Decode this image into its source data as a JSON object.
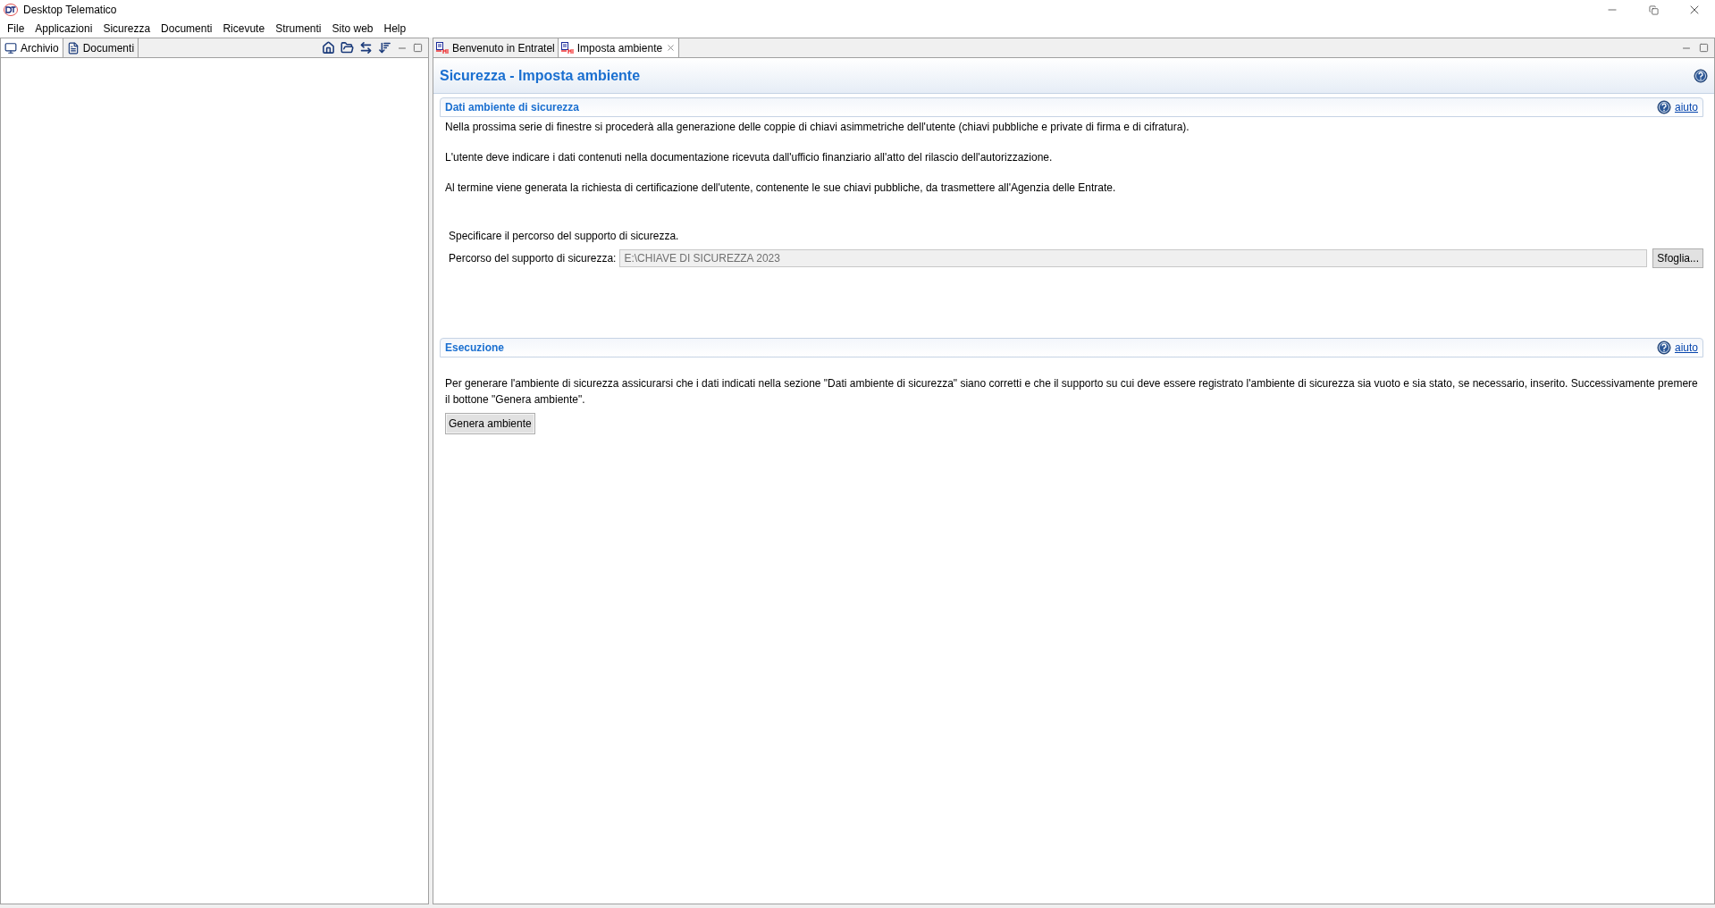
{
  "window": {
    "title": "Desktop Telematico"
  },
  "menu": [
    "File",
    "Applicazioni",
    "Sicurezza",
    "Documenti",
    "Ricevute",
    "Strumenti",
    "Sito web",
    "Help"
  ],
  "left_tabs": [
    {
      "label": "Archivio",
      "selected": true
    },
    {
      "label": "Documenti",
      "selected": false
    }
  ],
  "editor_tabs": [
    {
      "label": "Benvenuto in Entratel",
      "selected": false
    },
    {
      "label": "Imposta ambiente",
      "selected": true
    }
  ],
  "page_title": "Sicurezza - Imposta ambiente",
  "sections": [
    {
      "title": "Dati ambiente di sicurezza",
      "help": "aiuto",
      "paragraphs": [
        "Nella  prossima serie di finestre  si procederà  alla generazione delle coppie di chiavi asimmetriche dell'utente (chiavi pubbliche e private di firma e di cifratura).",
        "L'utente deve indicare i dati contenuti nella documentazione ricevuta dall'ufficio finanziario all'atto del rilascio dell'autorizzazione.",
        "Al termine viene generata la richiesta di certificazione dell'utente, contenente le sue chiavi pubbliche, da trasmettere all'Agenzia delle Entrate."
      ],
      "instruction": "Specificare il percorso del supporto di sicurezza.",
      "field": {
        "label": "Percorso del supporto di sicurezza:",
        "value": "E:\\CHIAVE DI SICUREZZA 2023",
        "disabled": true
      },
      "button": "Sfoglia..."
    },
    {
      "title": "Esecuzione",
      "help": "aiuto",
      "paragraphs": [
        "Per generare l'ambiente di sicurezza assicurarsi che i dati indicati nella sezione \"Dati ambiente di sicurezza\" siano corretti e che il supporto su cui deve essere registrato l'ambiente di sicurezza sia vuoto e sia stato, se necessario, inserito. Successivamente premere il bottone \"Genera ambiente\"."
      ],
      "button": "Genera ambiente"
    }
  ]
}
